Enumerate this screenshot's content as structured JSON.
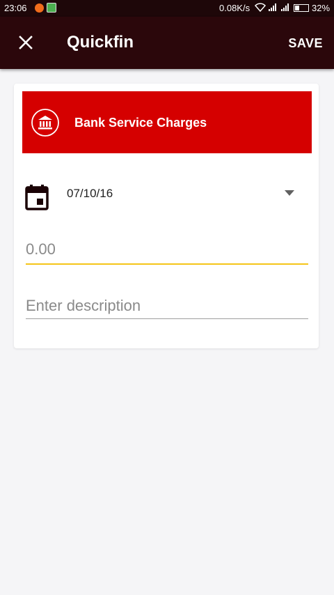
{
  "status_bar": {
    "time": "23:06",
    "network_speed": "0.08K/s",
    "battery_percent": "32%",
    "battery_level": 0.32
  },
  "toolbar": {
    "title": "Quickfin",
    "save_label": "SAVE",
    "background": "#2b070b"
  },
  "category": {
    "label": "Bank Service Charges",
    "icon": "bank-icon",
    "color": "#d50000"
  },
  "date": {
    "value": "07/10/16",
    "icon": "calendar-icon"
  },
  "amount": {
    "placeholder": "0.00",
    "value": "",
    "underline_color": "#f5c518"
  },
  "description": {
    "placeholder": "Enter description",
    "value": ""
  }
}
